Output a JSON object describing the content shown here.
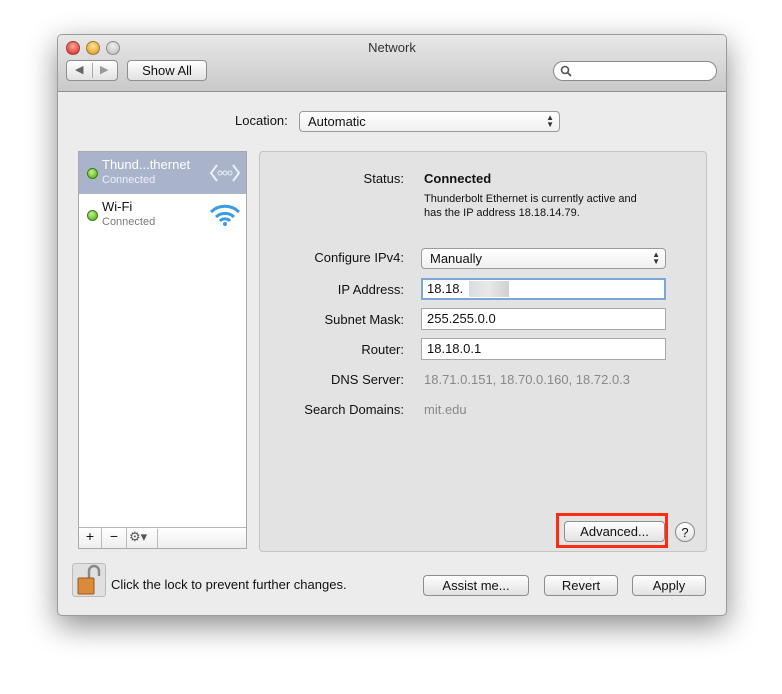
{
  "window": {
    "title": "Network",
    "show_all": "Show All",
    "search_placeholder": ""
  },
  "location": {
    "label": "Location:",
    "value": "Automatic"
  },
  "services": [
    {
      "name": "Thund...thernet",
      "status": "Connected",
      "icon": "thunderbolt-ethernet-icon",
      "selected": true
    },
    {
      "name": "Wi-Fi",
      "status": "Connected",
      "icon": "wifi-icon",
      "selected": false
    }
  ],
  "detail": {
    "status_label": "Status:",
    "status_value": "Connected",
    "status_desc_1": "Thunderbolt Ethernet is currently active and",
    "status_desc_2": "has the IP address 18.18.14.79.",
    "configure_label": "Configure IPv4:",
    "configure_value": "Manually",
    "ip_label": "IP Address:",
    "ip_value": "18.18.",
    "subnet_label": "Subnet Mask:",
    "subnet_value": "255.255.0.0",
    "router_label": "Router:",
    "router_value": "18.18.0.1",
    "dns_label": "DNS Server:",
    "dns_value": "18.71.0.151, 18.70.0.160, 18.72.0.3",
    "search_label": "Search Domains:",
    "search_value": "mit.edu",
    "advanced": "Advanced...",
    "help": "?"
  },
  "footer": {
    "lock_text": "Click the lock to prevent further changes.",
    "assist": "Assist me...",
    "revert": "Revert",
    "apply": "Apply"
  },
  "list_buttons": {
    "add": "+",
    "remove": "−"
  },
  "colors": {
    "highlight": "#ff2a12",
    "selection": "#a9b4cb",
    "focus": "#7aa6d8"
  }
}
